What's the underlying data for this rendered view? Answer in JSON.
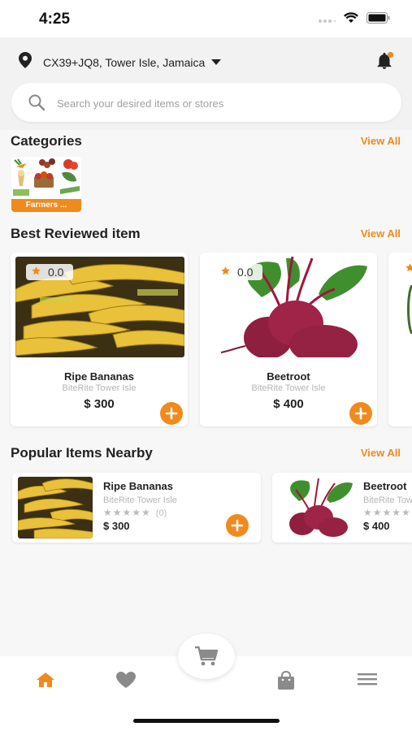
{
  "status": {
    "time": "4:25"
  },
  "header": {
    "location": "CX39+JQ8, Tower Isle, Jamaica"
  },
  "search": {
    "placeholder": "Search your desired items or stores"
  },
  "categories": {
    "title": "Categories",
    "view_all": "View All",
    "items": [
      {
        "label": "Farmers ..."
      }
    ]
  },
  "best_reviewed": {
    "title": "Best Reviewed item",
    "view_all": "View All",
    "items": [
      {
        "name": "Ripe Bananas",
        "store": "BiteRite Tower Isle",
        "price": "$ 300",
        "rating": "0.0"
      },
      {
        "name": "Beetroot",
        "store": "BiteRite Tower Isle",
        "price": "$ 400",
        "rating": "0.0"
      }
    ]
  },
  "popular": {
    "title": "Popular Items Nearby",
    "view_all": "View All",
    "items": [
      {
        "name": "Ripe Bananas",
        "store": "BiteRite Tower Isle",
        "rating_count": "(0)",
        "price": "$ 300"
      },
      {
        "name": "Beetroot",
        "store": "BiteRite Tower Isle",
        "price": "$ 400"
      }
    ]
  },
  "theme": {
    "accent": "#f08a1d",
    "nav_active": "#f08a1d",
    "nav_inactive": "#8a8a8a"
  },
  "icons": [
    "location-pin-icon",
    "caret-down-icon",
    "bell-icon",
    "search-icon",
    "star-icon",
    "plus-icon",
    "home-icon",
    "heart-icon",
    "cart-icon",
    "bag-icon",
    "menu-icon"
  ]
}
